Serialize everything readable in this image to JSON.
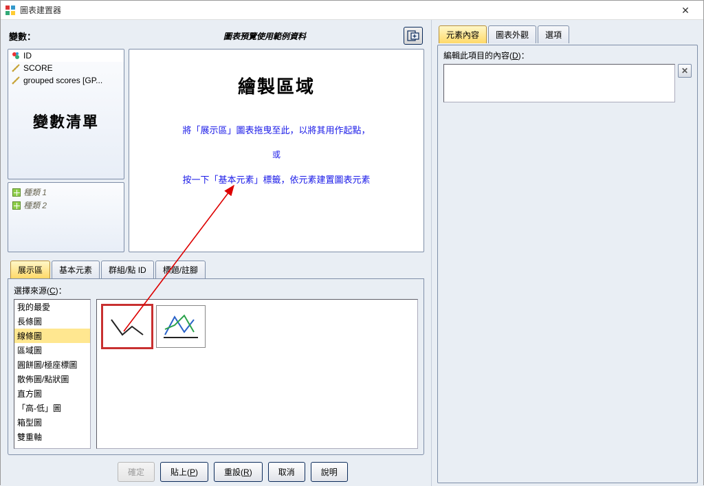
{
  "window": {
    "title": "圖表建置器"
  },
  "left": {
    "variables_label": "變數：",
    "preview_caption": "圖表預覽使用範例資料",
    "vars": [
      "ID",
      "SCORE",
      "grouped scores [GP..."
    ],
    "var_caption": "變數清單",
    "cats": [
      "種類 1",
      "種類 2"
    ],
    "drop": {
      "title": "繪製區域",
      "line1": "將「展示區」圖表拖曳至此，以將其用作起點，",
      "or": "或",
      "line2": "按一下「基本元素」標籤，依元素建置圖表元素"
    },
    "tabs": [
      "展示區",
      "基本元素",
      "群組/點 ID",
      "標題/註腳"
    ],
    "choose_source": "選擇來源(",
    "choose_source_u": "C",
    "choose_source2": ")：",
    "sources": [
      "我的最愛",
      "長條圖",
      "線條圖",
      "區域圖",
      "圓餅圖/極座標圖",
      "散佈圖/點狀圖",
      "直方圖",
      "「高-低」圖",
      "箱型圖",
      "雙重軸"
    ],
    "selected_source_index": 2,
    "buttons": {
      "ok": "確定",
      "paste": "貼上(",
      "paste_u": "P",
      "paste2": ")",
      "reset": "重設(",
      "reset_u": "R",
      "reset2": ")",
      "cancel": "取消",
      "help": "說明"
    }
  },
  "right": {
    "tabs": [
      "元素內容",
      "圖表外觀",
      "選項"
    ],
    "edit_label": "編輯此項目的內容(",
    "edit_label_u": "D",
    "edit_label2": ")："
  }
}
